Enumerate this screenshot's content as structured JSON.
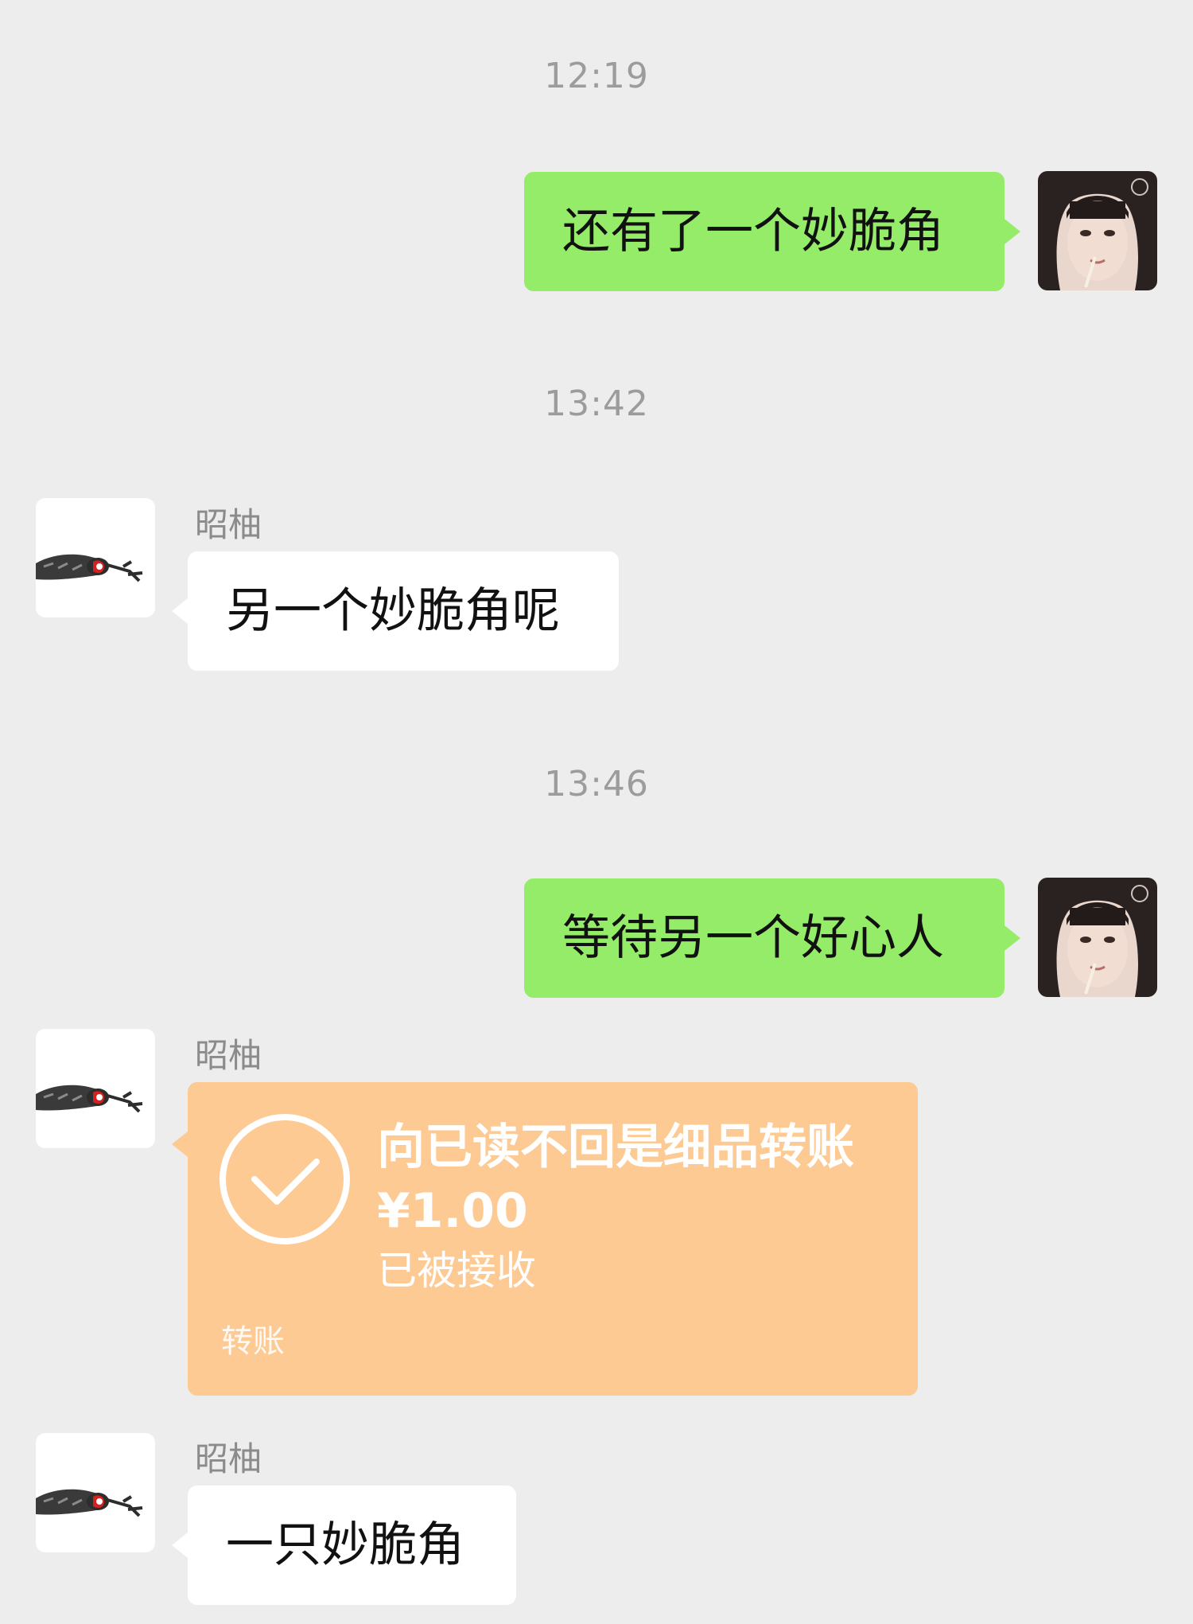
{
  "contact": {
    "name": "昭柚"
  },
  "messages": [
    {
      "type": "time",
      "text": "12:19"
    },
    {
      "type": "sent",
      "text": "还有了一个妙脆角"
    },
    {
      "type": "time",
      "text": "13:42"
    },
    {
      "type": "received",
      "sender": "昭柚",
      "text": "另一个妙脆角呢"
    },
    {
      "type": "time",
      "text": "13:46"
    },
    {
      "type": "sent",
      "text": "等待另一个好心人"
    },
    {
      "type": "transfer",
      "sender": "昭柚",
      "title": "向已读不回是细品转账",
      "amount": "¥1.00",
      "status": "已被接收",
      "label": "转账"
    },
    {
      "type": "received",
      "sender": "昭柚",
      "text": "一只妙脆角"
    }
  ],
  "icons": {
    "self_avatar": "user-avatar-photo",
    "contact_avatar": "contact-avatar-cat",
    "transfer_status": "check-circle-icon"
  },
  "colors": {
    "background": "#ededed",
    "sent_bubble": "#95ec69",
    "received_bubble": "#ffffff",
    "transfer_card": "#fdca94",
    "timestamp_text": "#9c9c9c"
  }
}
